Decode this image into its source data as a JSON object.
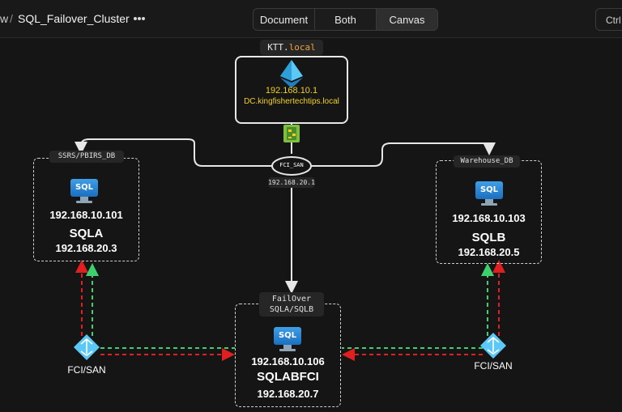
{
  "header": {
    "prev_crumb": "w",
    "separator": "/",
    "title": "SQL_Failover_Cluster",
    "more_icon": "more-horizontal-icon",
    "view_tabs": [
      {
        "label": "Document",
        "active": false
      },
      {
        "label": "Both",
        "active": false
      },
      {
        "label": "Canvas",
        "active": true
      }
    ],
    "shortcut_label": "Ctrl"
  },
  "diagram": {
    "domain": {
      "tag_prefix": "KTT.",
      "tag_suffix": "local",
      "ip": "192.168.10.1",
      "hostname": "DC.kingfishertechtips.local",
      "icon": "active-directory-icon"
    },
    "switch": {
      "label": "FCI_SAN",
      "ip": "192.168.20.1",
      "icon": "network-switch-icon"
    },
    "sqla": {
      "tag": "SSRS/PBIRS_DB",
      "icon_text": "SQL",
      "ip1": "192.168.10.101",
      "name": "SQLA",
      "ip2": "192.168.20.3"
    },
    "sqlb": {
      "tag": "Warehouse_DB",
      "icon_text": "SQL",
      "ip1": "192.168.10.103",
      "name": "SQLB",
      "ip2": "192.168.20.5"
    },
    "fci": {
      "tag_line1": "FailOver",
      "tag_line2": "SQLA/SQLB",
      "icon_text": "SQL",
      "ip1": "192.168.10.106",
      "name": "SQLABFCI",
      "ip2": "192.168.20.7"
    },
    "san_left": {
      "label": "FCI/SAN",
      "icon": "load-balancer-icon"
    },
    "san_right": {
      "label": "FCI/SAN",
      "icon": "load-balancer-icon"
    }
  },
  "colors": {
    "accent_yellow": "#f2d01e",
    "accent_orange": "#f0a23a",
    "link_red": "#e02020",
    "link_green": "#3ecf6e",
    "connector": "#e6e6e6"
  }
}
